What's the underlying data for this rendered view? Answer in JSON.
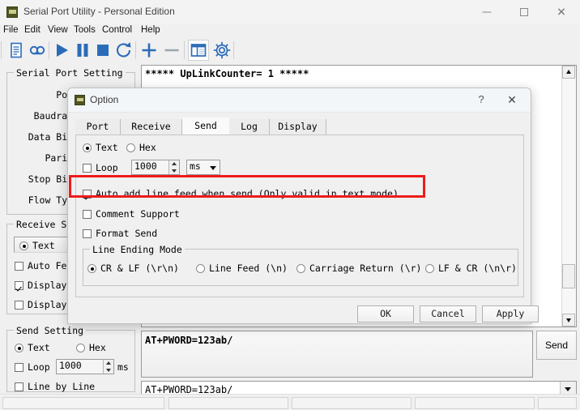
{
  "window": {
    "title": "Serial Port Utility - Personal Edition",
    "icon": "app-icon",
    "controls": {
      "minimize": "—",
      "maximize": "☐",
      "close": "✕"
    }
  },
  "menubar": [
    {
      "label": "File"
    },
    {
      "label": "Edit"
    },
    {
      "label": "View"
    },
    {
      "label": "Tools"
    },
    {
      "label": "Control"
    },
    {
      "label": "Help"
    }
  ],
  "toolbar": {
    "icons": [
      "new-file-icon",
      "record-icon",
      "play-icon",
      "pause-icon",
      "stop-icon",
      "refresh-icon",
      "add-icon",
      "remove-icon",
      "layout-panel-icon",
      "settings-gear-icon"
    ],
    "accent_color": "#2b6cb8"
  },
  "serial_port_setting": {
    "title": "Serial Port Setting",
    "labels": [
      "Port",
      "Baudrate",
      "Data Bits",
      "Parity",
      "Stop Bits",
      "Flow Type"
    ]
  },
  "receive_setting": {
    "title": "Receive Setting",
    "mode": "Text",
    "checkboxes": [
      {
        "label": "Auto Fe",
        "checked": false
      },
      {
        "label": "Display",
        "checked": true
      },
      {
        "label": "Display",
        "checked": false
      }
    ]
  },
  "send_setting": {
    "title": "Send Setting",
    "text_label": "Text",
    "hex_label": "Hex",
    "text_selected": true,
    "loop_label": "Loop",
    "loop_checked": false,
    "loop_value": "1000",
    "loop_unit": "ms",
    "line_by_line_label": "Line by Line",
    "line_by_line_checked": false
  },
  "receive_display": {
    "text": "***** UpLinkCounter= 1 *****"
  },
  "send_area": {
    "text": "AT+PWORD=123ab/",
    "send_button": "Send",
    "history_value": "AT+PWORD=123ab/"
  },
  "option_dialog": {
    "title": "Option",
    "help_glyph": "?",
    "close_glyph": "✕",
    "tabs": [
      {
        "label": "Port",
        "active": false
      },
      {
        "label": "Receive",
        "active": false
      },
      {
        "label": "Send",
        "active": true
      },
      {
        "label": "Log",
        "active": false
      },
      {
        "label": "Display",
        "active": false
      }
    ],
    "send_tab": {
      "format_text": "Text",
      "format_hex": "Hex",
      "format_selected": "Text",
      "loop_label": "Loop",
      "loop_checked": false,
      "loop_value": "1000",
      "loop_unit": "ms",
      "auto_line_feed": {
        "label": "Auto add line feed when send (Only valid in text mode)",
        "checked": true,
        "highlight_color": "#ee1b1b"
      },
      "comment_support": {
        "label": "Comment Support",
        "checked": false
      },
      "format_send": {
        "label": "Format Send",
        "checked": false
      },
      "line_ending_mode": {
        "title": "Line Ending Mode",
        "options": [
          {
            "label": "CR & LF (\\r\\n)",
            "selected": true
          },
          {
            "label": "Line Feed (\\n)",
            "selected": false
          },
          {
            "label": "Carriage Return (\\r)",
            "selected": false
          },
          {
            "label": "LF & CR (\\n\\r)",
            "selected": false
          }
        ]
      }
    },
    "buttons": {
      "ok": "OK",
      "cancel": "Cancel",
      "apply": "Apply"
    }
  }
}
